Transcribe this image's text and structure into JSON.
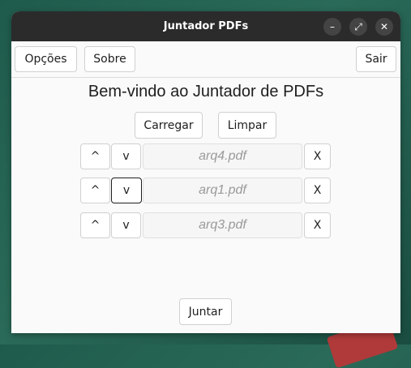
{
  "window": {
    "title": "Juntador PDFs",
    "controls": {
      "minimize": "–",
      "maximize": "⤢",
      "close": "✕"
    }
  },
  "toolbar": {
    "options_label": "Opções",
    "about_label": "Sobre",
    "quit_label": "Sair"
  },
  "main": {
    "heading": "Bem-vindo ao Juntador de PDFs",
    "load_label": "Carregar",
    "clear_label": "Limpar",
    "files": [
      {
        "up": "^",
        "down": "v",
        "name": "arq4.pdf",
        "remove": "X"
      },
      {
        "up": "^",
        "down": "v",
        "name": "arq1.pdf",
        "remove": "X"
      },
      {
        "up": "^",
        "down": "v",
        "name": "arq3.pdf",
        "remove": "X"
      }
    ],
    "merge_label": "Juntar"
  }
}
